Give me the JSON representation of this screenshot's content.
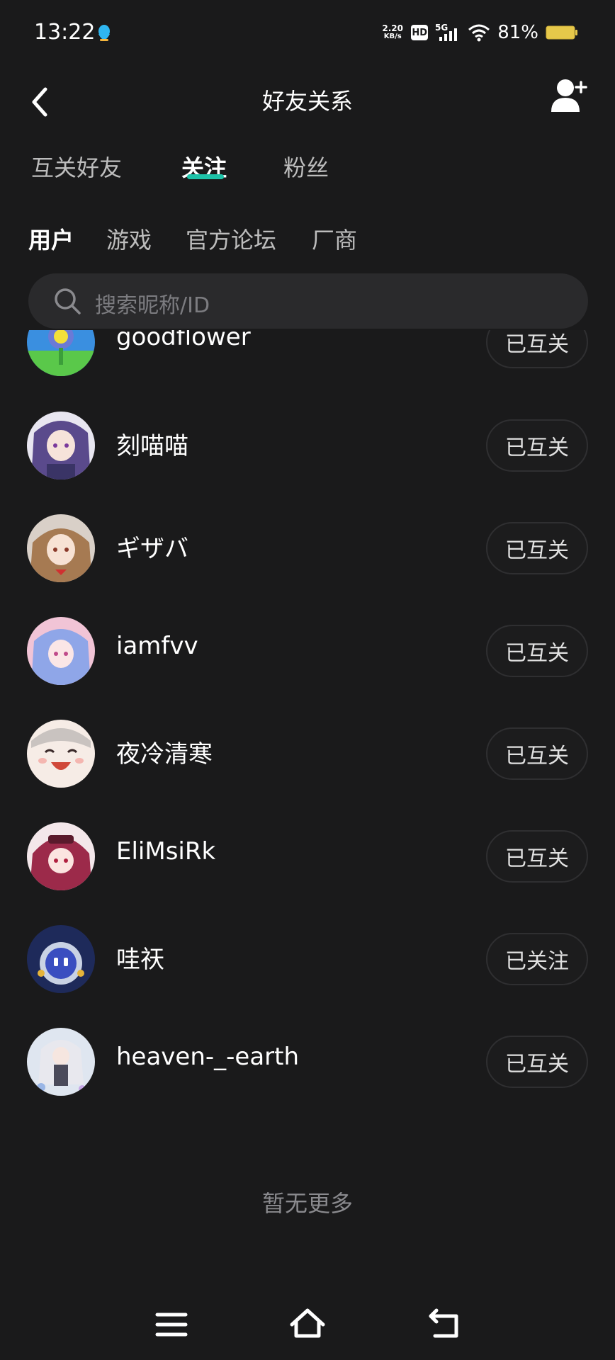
{
  "status_bar": {
    "time": "13:22",
    "net_speed_value": "2.20",
    "net_speed_unit": "KB/s",
    "hd": "HD",
    "network": "5G",
    "battery": "81%"
  },
  "nav": {
    "title": "好友关系"
  },
  "main_tabs": [
    {
      "label": "互关好友",
      "active": false
    },
    {
      "label": "关注",
      "active": true
    },
    {
      "label": "粉丝",
      "active": false
    }
  ],
  "sub_tabs": [
    {
      "label": "用户",
      "active": true
    },
    {
      "label": "游戏",
      "active": false
    },
    {
      "label": "官方论坛",
      "active": false
    },
    {
      "label": "厂商",
      "active": false
    }
  ],
  "search": {
    "placeholder": "搜索昵称/ID"
  },
  "list": [
    {
      "name": "goodflower",
      "button": "已互关"
    },
    {
      "name": "刻喵喵",
      "button": "已互关"
    },
    {
      "name": "ギザバ",
      "button": "已互关"
    },
    {
      "name": "iamfvv",
      "button": "已互关"
    },
    {
      "name": "夜冷清寒",
      "button": "已互关"
    },
    {
      "name": "EliMsiRk",
      "button": "已互关"
    },
    {
      "name": "哇祆",
      "button": "已关注"
    },
    {
      "name": "heaven-_-earth",
      "button": "已互关"
    }
  ],
  "footer": {
    "text": "暂无更多"
  },
  "colors": {
    "background": "#1a1a1b",
    "accent": "#1ec2a8"
  }
}
